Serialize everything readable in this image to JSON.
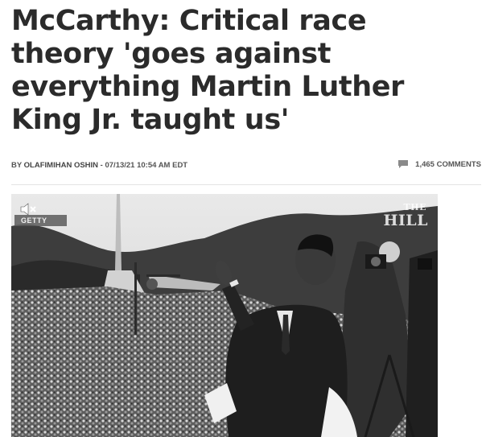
{
  "article": {
    "headline": "McCarthy: Critical race theory 'goes against everything Martin Luther King Jr. taught us'",
    "byline_prefix": "BY ",
    "author": "OLAFIMIHAN OSHIN",
    "separator": " - ",
    "timestamp": "07/13/21 10:54 AM EDT",
    "comments_label": "1,465 COMMENTS"
  },
  "media": {
    "credit": "GETTY",
    "watermark_line1": "THE",
    "watermark_line2": "HILL",
    "mute_icon": "speaker-muted-icon",
    "comment_icon": "speech-bubble-icon"
  },
  "colors": {
    "headline": "#2b2b2b",
    "meta": "#555555",
    "divider": "#e4e4e4"
  }
}
